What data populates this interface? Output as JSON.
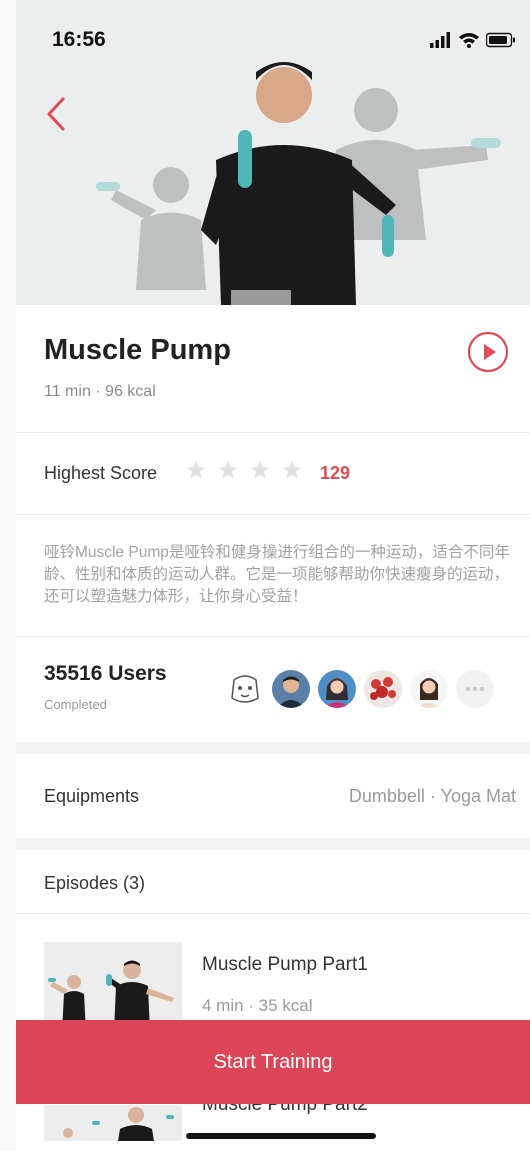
{
  "status": {
    "time": "16:56"
  },
  "workout": {
    "title": "Muscle Pump",
    "meta": "11 min · 96 kcal"
  },
  "score": {
    "label": "Highest Score",
    "value": "129",
    "stars_filled": 0,
    "stars_total": 4
  },
  "description": "哑铃Muscle Pump是哑铃和健身操进行组合的一种运动，适合不同年龄、性别和体质的运动人群。它是一项能够帮助你快速瘦身的运动，还可以塑造魅力体形，让你身心受益！",
  "users": {
    "count": "35516 Users",
    "sub": "Completed"
  },
  "equipments": {
    "label": "Equipments",
    "value": "Dumbbell · Yoga Mat"
  },
  "episodes": {
    "label": "Episodes (3)",
    "items": [
      {
        "title": "Muscle Pump Part1",
        "meta": "4 min · 35 kcal"
      },
      {
        "title": "Muscle Pump Part2"
      }
    ]
  },
  "cta": {
    "label": "Start Training"
  },
  "colors": {
    "accent": "#dc4656",
    "score": "#e24a58"
  }
}
